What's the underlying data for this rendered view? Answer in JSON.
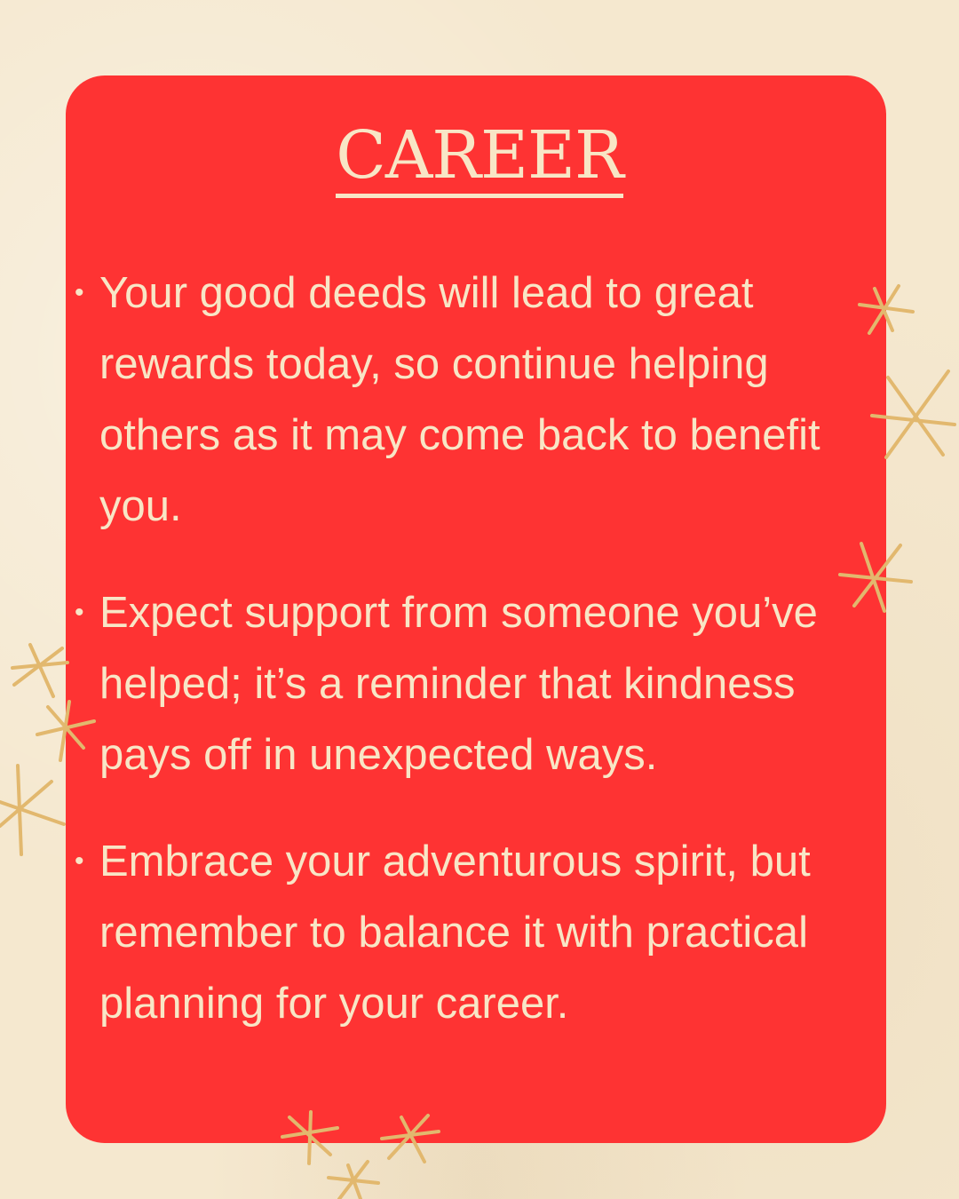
{
  "title": "Career",
  "bullets": [
    "Your good deeds will lead to great rewards today, so continue helping others as it may come back to benefit you.",
    "Expect support from someone you’ve helped; it’s a reminder that kindness pays off in unexpected ways.",
    "Embrace your adventurous spirit, but remember to balance it with practical planning for your career."
  ],
  "bullet_marker": "•",
  "colors": {
    "background": "#f5e8cf",
    "card": "#fe3333",
    "text": "#f8e6c6",
    "star": "#e2b86e"
  },
  "decorations": [
    "sparkle-star-icon"
  ]
}
